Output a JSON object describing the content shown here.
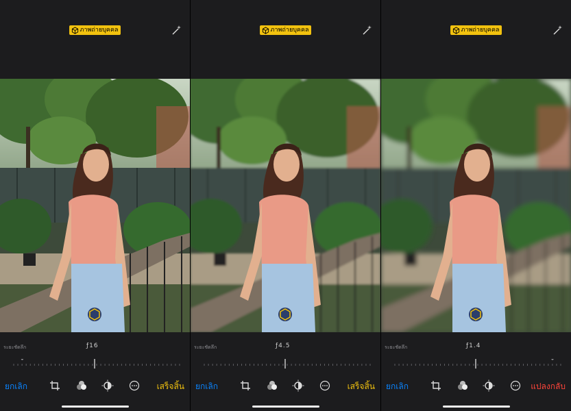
{
  "panels": [
    {
      "mode_label": "ภาพถ่ายบุคคล",
      "depth_label": "ระยะชัดลึก",
      "aperture": "ƒ16",
      "aperture_fraction": 1.0,
      "cancel_label": "ยกเลิก",
      "action_label": "เสร็จสิ้น",
      "action_color": "#f2c20f",
      "background_blur": 0
    },
    {
      "mode_label": "ภาพถ่ายบุคคล",
      "depth_label": "ระยะชัดลึก",
      "aperture": "ƒ4.5",
      "aperture_fraction": 0.56,
      "cancel_label": "ยกเลิก",
      "action_label": "เสร็จสิ้น",
      "action_color": "#f2c20f",
      "background_blur": 1.6
    },
    {
      "mode_label": "ภาพถ่ายบุคคล",
      "depth_label": "ระยะชัดลึก",
      "aperture": "ƒ1.4",
      "aperture_fraction": 0.0,
      "cancel_label": "ยกเลิก",
      "action_label": "แปลงกลับ",
      "action_color": "#ff453a",
      "background_blur": 3.5
    }
  ],
  "colors": {
    "accent_yellow": "#f2c20f",
    "accent_blue": "#0a84ff",
    "revert_red": "#ff453a",
    "panel_bg": "#1c1c1e"
  },
  "icons": [
    "cube-icon",
    "magic-wand-icon",
    "crop-icon",
    "filters-icon",
    "adjust-icon",
    "more-icon"
  ]
}
